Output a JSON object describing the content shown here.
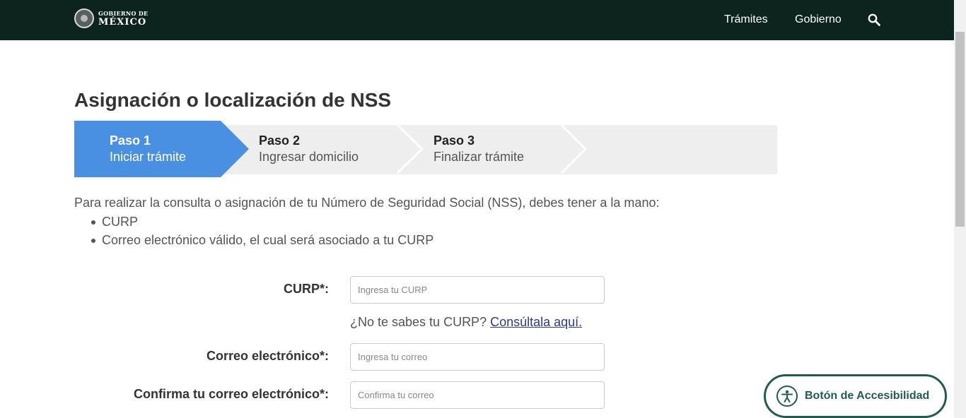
{
  "header": {
    "logo_line1": "GOBIERNO DE",
    "logo_line2": "MÉXICO",
    "nav": [
      {
        "label": "Trámites"
      },
      {
        "label": "Gobierno"
      }
    ],
    "search_icon": "search-icon"
  },
  "page": {
    "title": "Asignación o localización de NSS"
  },
  "stepper": {
    "steps": [
      {
        "title": "Paso 1",
        "subtitle": "Iniciar trámite",
        "active": true
      },
      {
        "title": "Paso 2",
        "subtitle": "Ingresar domicilio",
        "active": false
      },
      {
        "title": "Paso 3",
        "subtitle": "Finalizar trámite",
        "active": false
      }
    ],
    "active_color": "#4a90e2",
    "inactive_color": "#eeeeee"
  },
  "intro": {
    "text": "Para realizar la consulta o asignación de tu Número de Seguridad Social (NSS), debes tener a la mano:",
    "items": [
      "CURP",
      "Correo electrónico válido, el cual será asociado a tu CURP"
    ]
  },
  "form": {
    "curp": {
      "label": "CURP*:",
      "placeholder": "Ingresa tu CURP",
      "value": ""
    },
    "curp_help": {
      "text": "¿No te sabes tu CURP?",
      "link": "Consúltala aquí."
    },
    "email": {
      "label": "Correo electrónico*:",
      "placeholder": "Ingresa tu correo",
      "value": ""
    },
    "email_confirm": {
      "label": "Confirma tu correo electrónico*:",
      "placeholder": "Confirma tu correo",
      "value": ""
    }
  },
  "accessibility": {
    "label": "Botón de Accesibilidad",
    "icon": "accessibility-icon",
    "color": "#235b4e"
  },
  "colors": {
    "header_bg": "#0c231e",
    "link": "#2a3a8c"
  }
}
